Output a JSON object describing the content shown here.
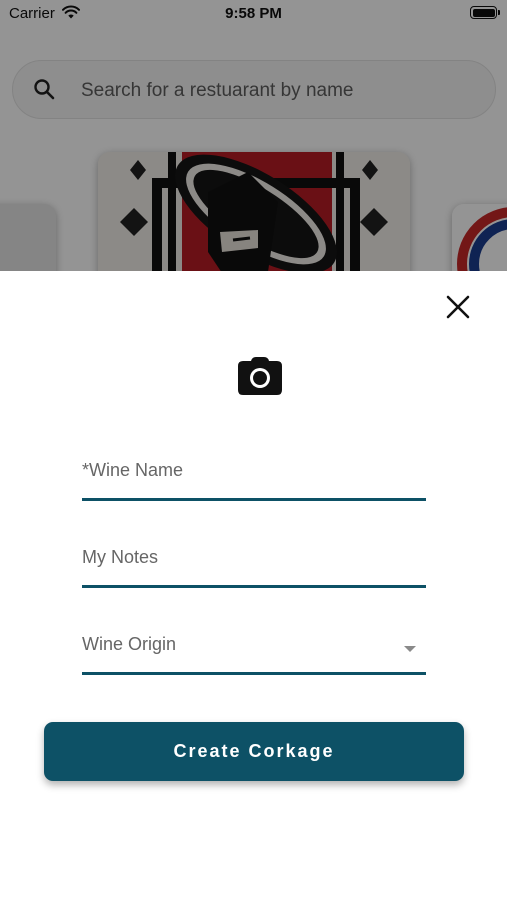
{
  "status_bar": {
    "carrier": "Carrier",
    "time": "9:58 PM"
  },
  "search": {
    "placeholder": "Search for a restuarant by name"
  },
  "modal": {
    "fields": {
      "wine_name": "*Wine Name",
      "notes": "My Notes",
      "origin": "Wine Origin"
    },
    "create_button": "Create Corkage"
  },
  "colors": {
    "accent": "#0d5166",
    "overlay": "rgba(0,0,0,0.42)"
  },
  "icons": [
    "wifi-icon",
    "battery-icon",
    "search-icon",
    "camera-icon",
    "close-icon",
    "chevron-down-icon"
  ]
}
